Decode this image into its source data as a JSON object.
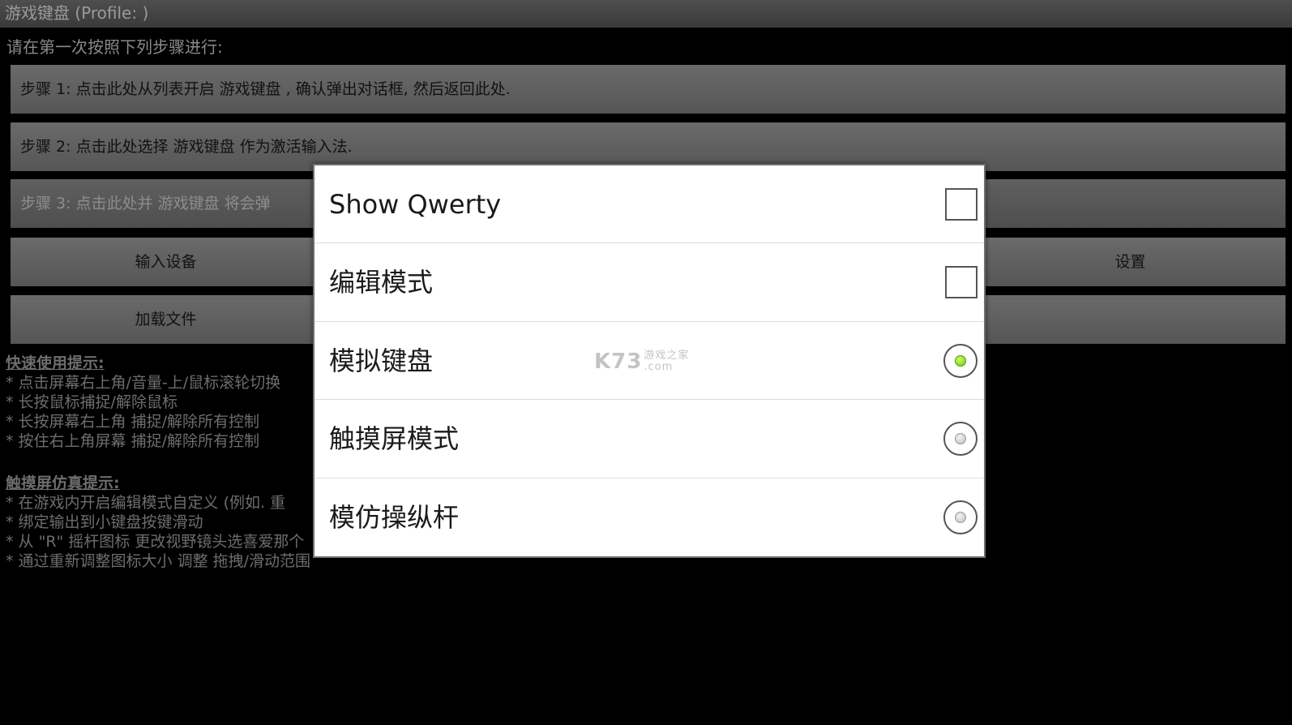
{
  "title": "游戏键盘 (Profile: )",
  "instructions": "请在第一次按照下列步骤进行:",
  "steps": [
    "步骤 1: 点击此处从列表开启 游戏键盘 , 确认弹出对话框, 然后返回此处.",
    "步骤 2: 点击此处选择 游戏键盘 作为激活输入法.",
    "步骤 3: 点击此处并 游戏键盘 将会弹"
  ],
  "buttons": {
    "input_device": "输入设备",
    "settings": "设置",
    "load_file": "加载文件"
  },
  "quick_tips": {
    "heading": "快速使用提示:",
    "items": [
      "* 点击屏幕右上角/音量-上/鼠标滚轮切换",
      "* 长按鼠标捕捉/解除鼠标",
      "* 长按屏幕右上角 捕捉/解除所有控制",
      "* 按住右上角屏幕 捕捉/解除所有控制"
    ]
  },
  "touch_tips": {
    "heading": "触摸屏仿真提示:",
    "items": [
      "* 在游戏内开启编辑模式自定义 (例如. 重",
      "* 绑定输出到小键盘按键滑动",
      "* 从 \"R\" 摇杆图标 更改视野镜头选喜爱那个",
      "* 通过重新调整图标大小 调整 拖拽/滑动范围"
    ]
  },
  "dialog": {
    "options": [
      {
        "label": "Show Qwerty",
        "control": "checkbox",
        "checked": false
      },
      {
        "label": "编辑模式",
        "control": "checkbox",
        "checked": false
      },
      {
        "label": "模拟键盘",
        "control": "radio",
        "checked": true
      },
      {
        "label": "触摸屏模式",
        "control": "radio",
        "checked": false
      },
      {
        "label": "模仿操纵杆",
        "control": "radio",
        "checked": false
      }
    ],
    "watermark": {
      "main": "K73",
      "sub1": "游戏之家",
      "sub2": ".com"
    }
  },
  "colors": {
    "background": "#000000",
    "button": "#606060",
    "dialog": "#ffffff",
    "radio_selected": "#6fc80a"
  }
}
